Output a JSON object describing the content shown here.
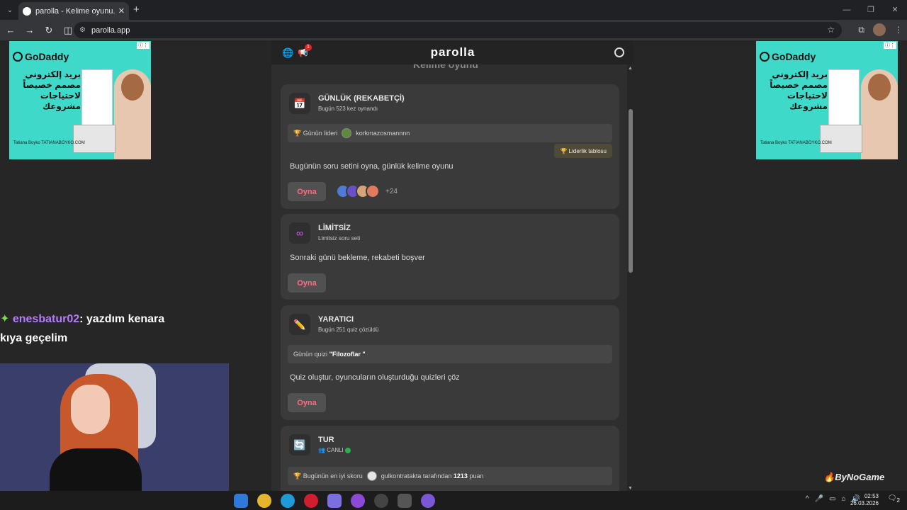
{
  "browser": {
    "tab_title": "parolla - Kelime oyunu. Günlü",
    "url": "parolla.app"
  },
  "ads": {
    "brand": "GoDaddy",
    "arabic_text": "بريد إلكتروني مصمم خصيصاً لاحتياجات مشروعك",
    "credit": "Tatiana Boyko TATIANABOYKO.COM"
  },
  "chat": {
    "username": "enesbatur02",
    "message": ": yazdım kenara",
    "line2": "kıya geçelim"
  },
  "watermark": "ByNoGame",
  "app": {
    "brand": "parolla",
    "notification_count": "1",
    "peek_title": "Kelime oyunu",
    "cards": {
      "daily": {
        "title": "GÜNLÜK (REKABETÇİ)",
        "subtitle": "Bugün 523 kez oynandı",
        "leader_label": "Günün lideri",
        "leader_name": "korkmazosmannnn",
        "leaderboard_btn": "🏆 Liderlik tablosu",
        "description": "Bugünün soru setini oyna, günlük kelime oyunu",
        "play": "Oyna",
        "more_players": "+24"
      },
      "unlimited": {
        "title": "LİMİTSİZ",
        "subtitle": "Limitsiz soru seti",
        "description": "Sonraki günü bekleme, rekabeti boşver",
        "play": "Oyna"
      },
      "creator": {
        "title": "YARATICI",
        "subtitle": "Bugün 251 quiz çözüldü",
        "quiz_label": "Günün quizi",
        "quiz_name": "\"Filozoflar \"",
        "description": "Quiz oluştur, oyuncuların oluşturduğu quizleri çöz",
        "play": "Oyna"
      },
      "tour": {
        "title": "TUR",
        "subtitle": "CANLI",
        "best_label": "Bugünün en iyi skoru",
        "best_user": "gulkontratakta tarafından",
        "best_score": "1213",
        "best_unit": "puan"
      }
    }
  },
  "taskbar": {
    "time": "02:53",
    "date": "26.03.2026",
    "notifications": "2"
  }
}
